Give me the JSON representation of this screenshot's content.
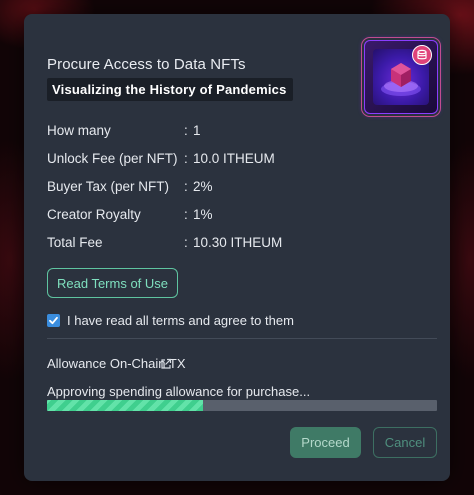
{
  "modal": {
    "title": "Procure Access to Data NFTs",
    "nft_name": "Visualizing the History of Pandemics",
    "details": [
      {
        "label": "How many",
        "value": "1"
      },
      {
        "label": "Unlock Fee (per NFT)",
        "value": "10.0 ITHEUM"
      },
      {
        "label": "Buyer Tax (per NFT)",
        "value": "2%"
      },
      {
        "label": "Creator Royalty",
        "value": "1%"
      },
      {
        "label": "Total Fee",
        "value": "10.30 ITHEUM"
      }
    ],
    "separator": ":",
    "terms_button": "Read Terms of Use",
    "agree_checked": true,
    "agree_label": "I have read all terms and agree to them",
    "allowance_link": "Allowance On-Chain TX",
    "status_text": "Approving spending allowance for purchase...",
    "progress_fraction": 0.4,
    "proceed_label": "Proceed",
    "cancel_label": "Cancel"
  },
  "icons": {
    "thumbnail": "nft-thumbnail",
    "badge": "database-icon",
    "external": "external-link-icon",
    "checkbox": "check-icon"
  },
  "colors": {
    "modal_bg": "#2b323e",
    "accent_green": "#5fc4a0",
    "progress_green": "#3fcf8e",
    "checkbox_blue": "#3a8dde"
  }
}
